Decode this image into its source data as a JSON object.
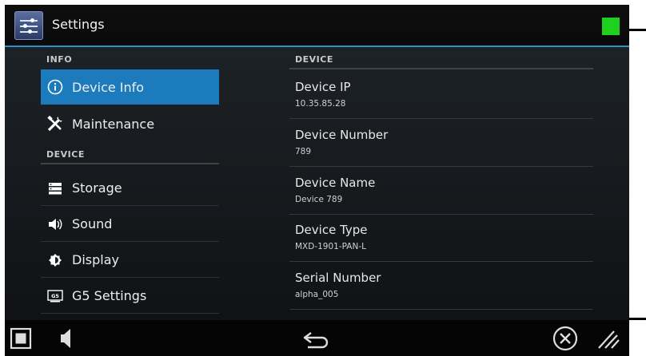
{
  "title_bar": {
    "title": "Settings",
    "status_color": "#1fd11f"
  },
  "left_panel": {
    "info_header": "INFO",
    "device_header": "DEVICE",
    "items": [
      {
        "label": "Device Info",
        "icon": "info-icon",
        "active": true
      },
      {
        "label": "Maintenance",
        "icon": "tools-icon",
        "active": false
      },
      {
        "label": "Storage",
        "icon": "storage-icon",
        "active": false
      },
      {
        "label": "Sound",
        "icon": "speaker-icon",
        "active": false
      },
      {
        "label": "Display",
        "icon": "brightness-icon",
        "active": false
      },
      {
        "label": "G5 Settings",
        "icon": "g5-icon",
        "active": false
      }
    ]
  },
  "right_panel": {
    "header": "DEVICE",
    "rows": [
      {
        "label": "Device IP",
        "value": "10.35.85.28"
      },
      {
        "label": "Device Number",
        "value": "789"
      },
      {
        "label": "Device Name",
        "value": "Device 789"
      },
      {
        "label": "Device Type",
        "value": "MXD-1901-PAN-L"
      },
      {
        "label": "Serial Number",
        "value": "alpha_005"
      }
    ]
  },
  "bottom_bar": {
    "icons": [
      "stop-square-icon",
      "volume-icon",
      "back-arrow-icon",
      "close-circle-icon",
      "resize-grip-icon"
    ]
  },
  "colors": {
    "accent": "#1c7bbd",
    "title_rule": "#2f8fc8"
  }
}
